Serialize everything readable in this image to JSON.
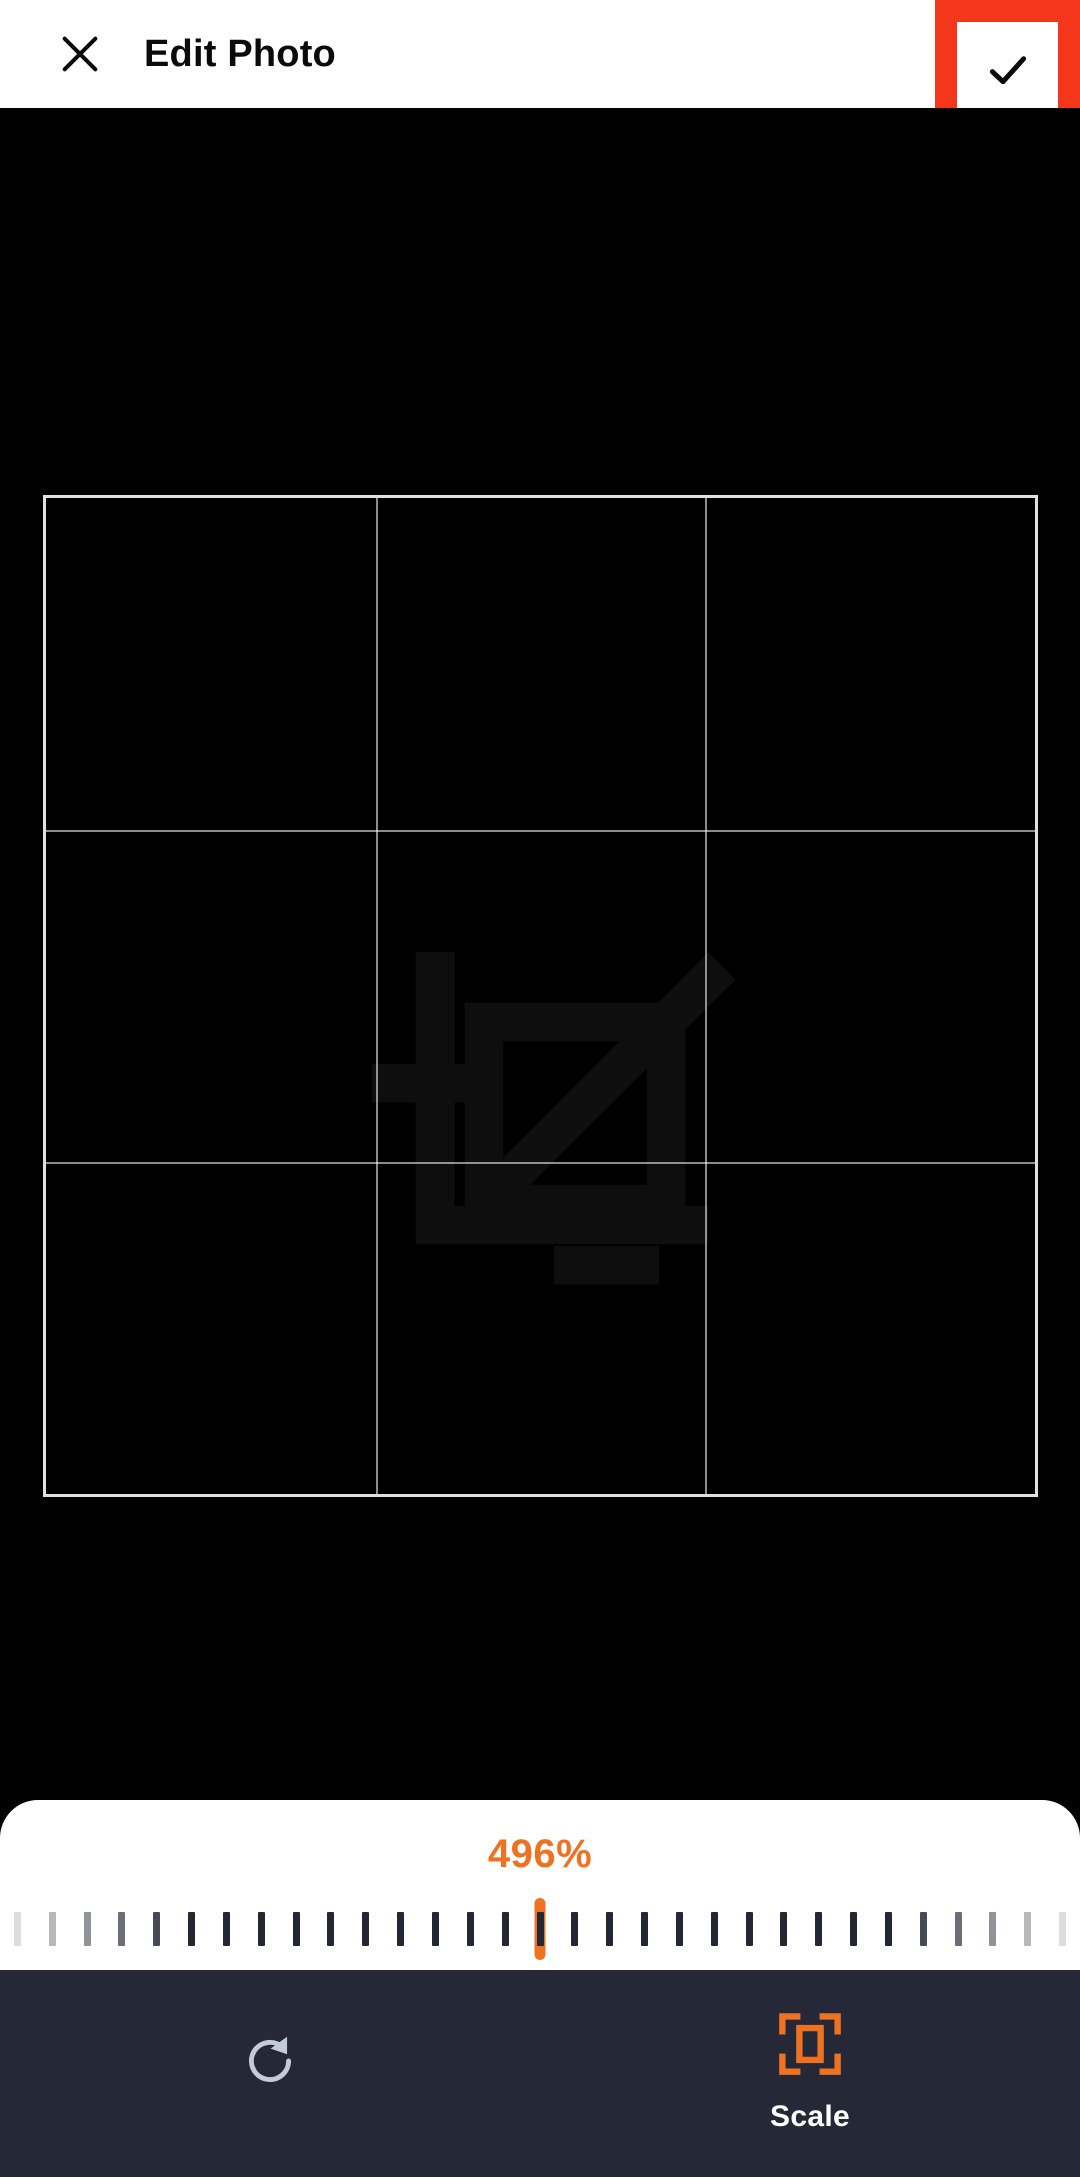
{
  "header": {
    "title": "Edit Photo",
    "close_icon": "close-x-icon",
    "confirm_icon": "checkmark-icon",
    "highlight_color": "#f4371a"
  },
  "canvas": {
    "background_color": "#000000",
    "grid": {
      "rows": 3,
      "columns": 3,
      "line_color": "#ffffff",
      "frame_color": "#ffffff"
    },
    "placeholder_icon": "image-resize-placeholder-icon"
  },
  "slider": {
    "value_label": "496%",
    "value_number": 496,
    "unit": "%",
    "accent_color": "#ef7223",
    "indicator_position_percent": 50,
    "ticks_total": 31,
    "ticks_left_of_indicator": 15,
    "ticks_right_of_indicator": 15,
    "tick_color": "#222733",
    "sheet_color": "#ffffff"
  },
  "toolbar": {
    "background_color": "#252836",
    "items": [
      {
        "name": "rotate",
        "label": "",
        "icon": "rotate-clockwise-icon",
        "active": false,
        "color": "#c3cbd8"
      },
      {
        "name": "scale",
        "label": "Scale",
        "icon": "scale-icon",
        "active": true,
        "color": "#ef7223"
      }
    ]
  }
}
